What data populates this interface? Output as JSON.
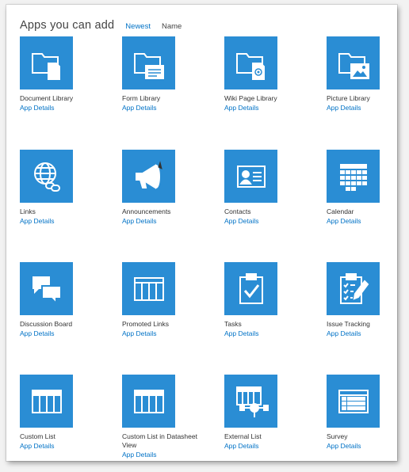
{
  "header": {
    "title": "Apps you can add",
    "sort_newest": "Newest",
    "sort_name": "Name"
  },
  "colors": {
    "tile": "#2a8dd4",
    "link": "#0072c6"
  },
  "apps": [
    {
      "name": "Document Library",
      "details": "App Details",
      "icon": "document-library-icon"
    },
    {
      "name": "Form Library",
      "details": "App Details",
      "icon": "form-library-icon"
    },
    {
      "name": "Wiki Page Library",
      "details": "App Details",
      "icon": "wiki-page-library-icon"
    },
    {
      "name": "Picture Library",
      "details": "App Details",
      "icon": "picture-library-icon"
    },
    {
      "name": "Links",
      "details": "App Details",
      "icon": "links-globe-icon"
    },
    {
      "name": "Announcements",
      "details": "App Details",
      "icon": "megaphone-icon"
    },
    {
      "name": "Contacts",
      "details": "App Details",
      "icon": "contact-card-icon"
    },
    {
      "name": "Calendar",
      "details": "App Details",
      "icon": "calendar-icon"
    },
    {
      "name": "Discussion Board",
      "details": "App Details",
      "icon": "speech-bubbles-icon"
    },
    {
      "name": "Promoted Links",
      "details": "App Details",
      "icon": "promoted-links-icon"
    },
    {
      "name": "Tasks",
      "details": "App Details",
      "icon": "clipboard-check-icon"
    },
    {
      "name": "Issue Tracking",
      "details": "App Details",
      "icon": "clipboard-edit-icon"
    },
    {
      "name": "Custom List",
      "details": "App Details",
      "icon": "custom-list-icon"
    },
    {
      "name": "Custom List in Datasheet View",
      "details": "App Details",
      "icon": "datasheet-icon"
    },
    {
      "name": "External List",
      "details": "App Details",
      "icon": "external-list-icon"
    },
    {
      "name": "Survey",
      "details": "App Details",
      "icon": "survey-icon"
    }
  ]
}
